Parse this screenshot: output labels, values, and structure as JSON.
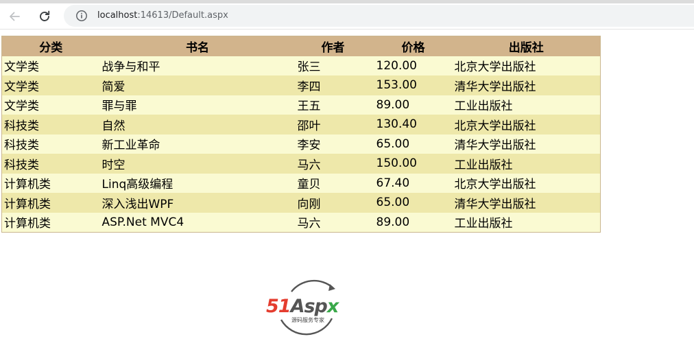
{
  "browser": {
    "url_host": "localhost",
    "url_rest": ":14613/Default.aspx"
  },
  "grid": {
    "headers": [
      "分类",
      "书名",
      "作者",
      "价格",
      "出版社"
    ],
    "rows": [
      [
        "文学类",
        "战争与和平",
        "张三",
        "120.00",
        "北京大学出版社"
      ],
      [
        "文学类",
        "简爱",
        "李四",
        "153.00",
        "清华大学出版社"
      ],
      [
        "文学类",
        "罪与罪",
        "王五",
        "89.00",
        "工业出版社"
      ],
      [
        "科技类",
        "自然",
        "邵叶",
        "130.40",
        "北京大学出版社"
      ],
      [
        "科技类",
        "新工业革命",
        "李安",
        "65.00",
        "清华大学出版社"
      ],
      [
        "科技类",
        "时空",
        "马六",
        "150.00",
        "工业出版社"
      ],
      [
        "计算机类",
        "Linq高级编程",
        "童贝",
        "67.40",
        "北京大学出版社"
      ],
      [
        "计算机类",
        "深入浅出WPF",
        "向刚",
        "65.00",
        "清华大学出版社"
      ],
      [
        "计算机类",
        "ASP.Net MVC4",
        "马六",
        "89.00",
        "工业出版社"
      ]
    ]
  },
  "logo": {
    "part1": "51",
    "part2": "Asp",
    "part3": "x",
    "subtitle": "源码服务专家",
    "colors": {
      "red": "#e43d2f",
      "gray": "#555555",
      "green": "#39a849"
    }
  },
  "colors": {
    "header_bg": "#d2b48c",
    "row_odd": "#fafad2",
    "row_even": "#eee8aa"
  }
}
